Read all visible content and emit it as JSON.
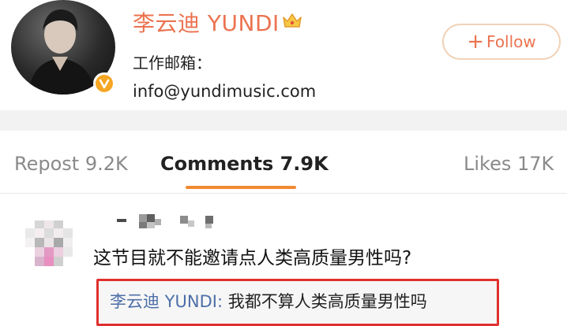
{
  "profile": {
    "name": "李云迪 YUNDI",
    "info_label": "工作邮箱：",
    "email": "info@yundimusic.com",
    "follow_label": "Follow",
    "follow_plus": "+"
  },
  "tabs": [
    {
      "label": "Repost 9.2K",
      "active": false
    },
    {
      "label": "Comments 7.9K",
      "active": true
    },
    {
      "label": "Likes 17K",
      "active": false
    }
  ],
  "comment": {
    "text": "这节目就不能邀请点人类高质量男性吗?",
    "reply": {
      "author": "李云迪 YUNDI",
      "separator": ": ",
      "text": "我都不算人类高质量男性吗"
    }
  },
  "colors": {
    "brand_orange": "#eb7350",
    "tab_underline": "#f08a32",
    "reply_link": "#4d6fa8",
    "highlight_border": "#e0302f",
    "verified_badge": "#f5a623"
  },
  "icons": {
    "crown": "crown-icon",
    "verified": "verified-badge-icon",
    "follow": "plus-icon"
  }
}
